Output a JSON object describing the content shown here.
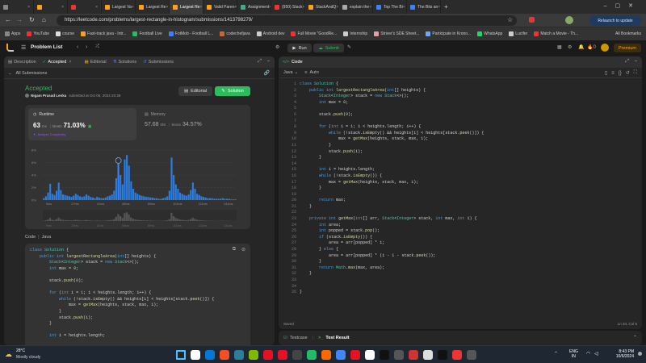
{
  "browser": {
    "tabs": [
      {
        "label": "",
        "color": "#888"
      },
      {
        "label": "",
        "color": "#ffa116"
      },
      {
        "label": "",
        "color": "#e33"
      },
      {
        "label": "Largest Va",
        "color": "#ffa116"
      },
      {
        "label": "Largest Re",
        "color": "#ffa116"
      },
      {
        "label": "Largest Re",
        "color": "#ffa116"
      },
      {
        "label": "Valid Paren",
        "color": "#ffa116"
      },
      {
        "label": "Assignment",
        "color": "#4a8"
      },
      {
        "label": "(950) Stack",
        "color": "#e33"
      },
      {
        "label": "StackAndQ",
        "color": "#ffa116"
      },
      {
        "label": "explain the",
        "color": "#aaa"
      },
      {
        "label": "Top The Bi",
        "color": "#3b82f6"
      },
      {
        "label": "The Bits an",
        "color": "#3b82f6"
      }
    ],
    "url": "https://leetcode.com/problems/largest-rectangle-in-histogram/submissions/1413798279/",
    "update_label": "Relaunch to update",
    "bookmarks": [
      "Apps",
      "YouTube",
      "course",
      "Fast-track java - Intr...",
      "Football Live",
      "FotMob - Football L...",
      "codechefjava",
      "Android dev",
      "Full Movie \"GoodRe...",
      "Internship",
      "Striver's SDE Sheet...",
      "Participate in Krono...",
      "WhatsApp",
      "Lucifer",
      "Match a Movie - Th..."
    ],
    "all_bookmarks": "All Bookmarks"
  },
  "leetcode": {
    "problem_list": "Problem List",
    "run": "Run",
    "submit": "Submit",
    "premium": "Premium",
    "streak": "0"
  },
  "left": {
    "tabs": [
      "Description",
      "Accepted",
      "Editorial",
      "Solutions",
      "Submissions"
    ],
    "all_submissions": "All Submissions",
    "status": "Accepted",
    "author": "Nigam Prasad Lenka",
    "submitted": "submitted at Oct 06, 2024 20:39",
    "editorial_btn": "Editorial",
    "solution_btn": "Solution",
    "runtime_label": "Runtime",
    "runtime_value": "63",
    "runtime_unit": "ms",
    "beats_label": "Beats",
    "runtime_beats": "71.03%",
    "analyze": "Analyze Complexity",
    "memory_label": "Memory",
    "memory_value": "57.68",
    "memory_unit": "MB",
    "memory_beats": "34.57%",
    "code_label": "Code",
    "code_lang": "Java"
  },
  "chart_data": {
    "type": "bar",
    "ylabels": [
      "8%",
      "6%",
      "4%",
      "2%",
      "0%"
    ],
    "xlabels": [
      "9ms",
      "27ms",
      "41ms",
      "65ms",
      "89ms",
      "101ms",
      "121ms",
      "141ms"
    ],
    "values": [
      0.3,
      0.6,
      1.2,
      2.6,
      1.0,
      0.8,
      1.5,
      2.8,
      1.6,
      0.9,
      0.8,
      0.7,
      0.6,
      0.5,
      0.7,
      1.0,
      0.8,
      0.6,
      0.5,
      0.6,
      0.9,
      0.7,
      0.5,
      0.4,
      0.3,
      0.5,
      0.4,
      0.3,
      0.3,
      0.4,
      0.6,
      0.7,
      0.9,
      1.5,
      3.5,
      5.8,
      4.0,
      2.5,
      6.5,
      7.2,
      5.5,
      3.0,
      1.8,
      1.2,
      1.0,
      0.8,
      0.7,
      0.6,
      0.5,
      0.5,
      0.4,
      0.4,
      0.3,
      0.3,
      0.2,
      0.2,
      0.3,
      0.4,
      0.6,
      1.5,
      6.8,
      4.0,
      2.5,
      1.8,
      1.2,
      1.0,
      0.8,
      0.7,
      0.9,
      1.6,
      2.8,
      1.8,
      1.0,
      0.8,
      0.6,
      0.5,
      0.4,
      0.3,
      0.3,
      0.3,
      0.2,
      0.2,
      0.2,
      0.2,
      0.3,
      0.2,
      0.2,
      0.2,
      0.1,
      0.1,
      0.1
    ],
    "ylim": [
      0,
      8
    ],
    "highlight_index": 35
  },
  "left_code": [
    "class Solution {",
    "    public int largestRectangleArea(int[] heights) {",
    "        Stack<Integer> stack = new Stack<>();",
    "        int max = 0;",
    "",
    "        stack.push(0);",
    "",
    "        for (int i = 1; i < heights.length; i++) {",
    "            while (!stack.isEmpty() && heights[i] < heights[stack.peek()]) {",
    "                max = getMax(heights, stack, max, i);",
    "            }",
    "            stack.push(i);",
    "        }",
    "",
    "        int i = heights.length;"
  ],
  "editor": {
    "title": "Code",
    "lang": "Java",
    "auto": "Auto",
    "saved": "Saved",
    "cursor": "Ln 34, Col 5",
    "lines": [
      "class Solution {",
      "    public int largestRectangleArea(int[] heights) {",
      "        Stack<Integer> stack = new Stack<>();",
      "        int max = 0;",
      "",
      "        stack.push(0);",
      "",
      "        for (int i = 1; i < heights.length; i++) {",
      "            while (!stack.isEmpty() && heights[i] < heights[stack.peek()]) {",
      "                max = getMax(heights, stack, max, i);",
      "            }",
      "            stack.push(i);",
      "        }",
      "",
      "        int i = heights.length;",
      "        while (!stack.isEmpty()) {",
      "            max = getMax(heights, stack, max, i);",
      "        }",
      "",
      "        return max;",
      "    }",
      "",
      "    private int getMax(int[] arr, Stack<Integer> stack, int max, int i) {",
      "        int area;",
      "        int popped = stack.pop();",
      "        if (stack.isEmpty()) {",
      "            area = arr[popped] * i;",
      "        } else {",
      "            area = arr[popped] * (i - 1 - stack.peek());",
      "        }",
      "        return Math.max(max, area);",
      "    }",
      "",
      "",
      "}"
    ]
  },
  "bottom": {
    "testcase": "Testcase",
    "result": "Test Result"
  },
  "taskbar": {
    "weather_temp": "28°C",
    "weather_desc": "Mostly cloudy",
    "lang1": "ENG",
    "lang2": "IN",
    "time": "8:43 PM",
    "date": "10/6/2024",
    "icons": [
      "#ffb900",
      "#ffffff",
      "#0078d4",
      "#f25022",
      "#2d7d9a",
      "#7fba00",
      "#e81123",
      "#e81123",
      "#444",
      "#2b6",
      "#ff6a00",
      "#4285f4",
      "#e81123",
      "#ffffff",
      "#111",
      "#555",
      "#c33",
      "#ddd",
      "#111",
      "#e33",
      "#555"
    ]
  }
}
